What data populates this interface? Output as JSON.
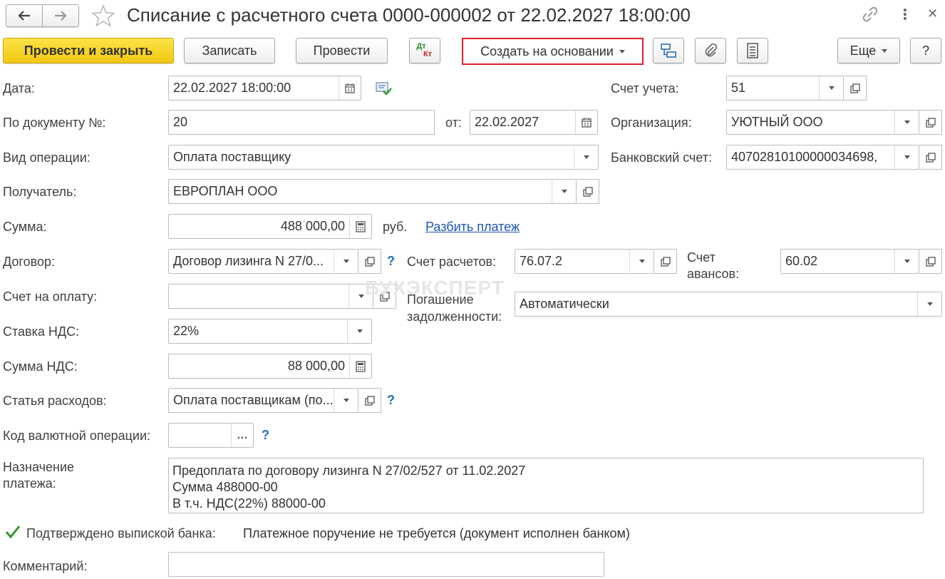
{
  "title": "Списание с расчетного счета 0000-000002 от 22.02.2027 18:00:00",
  "toolbar": {
    "post_close": "Провести и закрыть",
    "save": "Записать",
    "post": "Провести",
    "dtkt_dt": "Дт",
    "dtkt_kt": "Кт",
    "create_based": "Создать на основании",
    "more": "Еще",
    "help": "?"
  },
  "labels": {
    "date": "Дата:",
    "doc_number": "По документу №:",
    "from": "от:",
    "operation": "Вид операции:",
    "recipient": "Получатель:",
    "sum": "Сумма:",
    "currency": "руб.",
    "split": "Разбить платеж",
    "contract": "Договор:",
    "invoice": "Счет на оплату:",
    "vat_rate": "Ставка НДС:",
    "vat_sum": "Сумма НДС:",
    "expense_item": "Статья расходов:",
    "currency_op_code": "Код валютной операции:",
    "purpose_1": "Назначение",
    "purpose_2": "платежа:",
    "confirmed": "Подтверждено выпиской банка:",
    "comment": "Комментарий:",
    "account": "Счет учета:",
    "organization": "Организация:",
    "bank_account": "Банковский счет:",
    "settlement_account": "Счет расчетов:",
    "advance_account_1": "Счет",
    "advance_account_2": "авансов:",
    "debt_repayment_1": "Погашение",
    "debt_repayment_2": "задолженности:"
  },
  "values": {
    "date": "22.02.2027 18:00:00",
    "doc_number": "20",
    "doc_date": "22.02.2027",
    "operation": "Оплата поставщику",
    "recipient": "ЕВРОПЛАН ООО",
    "sum": "488 000,00",
    "contract": "Договор лизинга N 27/0...",
    "invoice": "",
    "vat_rate": "22%",
    "vat_sum": "88 000,00",
    "expense_item": "Оплата поставщикам (по...",
    "currency_op_code": "",
    "purpose_line1": "Предоплата по договору лизинга N 27/02/527 от 11.02.2027",
    "purpose_line2": "Сумма 488000-00",
    "purpose_line3": "В т.ч. НДС(22%) 88000-00",
    "confirmed_text": "Платежное поручение не требуется (документ исполнен банком)",
    "comment": "",
    "account": "51",
    "organization": "УЮТНЫЙ ООО",
    "bank_account": "40702810100000034698,",
    "settlement_account": "76.07.2",
    "advance_account": "60.02",
    "debt_repayment": "Автоматически"
  },
  "watermark": "БУХЭКСПЕРТ",
  "colors": {
    "primary_button": "#f5d116",
    "link": "#1a55b5",
    "highlight_border": "#e0202a",
    "check": "#2e9a2e"
  }
}
